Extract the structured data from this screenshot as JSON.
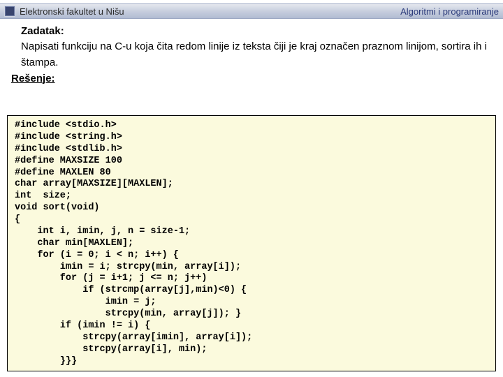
{
  "topbar": {
    "left": "Elektronski fakultet u Nišu",
    "right": "Algoritmi i programiranje"
  },
  "task": {
    "title": "Zadatak:",
    "body": "Napisati funkciju na C-u koja čita redom linije iz teksta čiji je kraj označen praznom linijom, sortira ih i štampa."
  },
  "solution": {
    "title": "Rešenje:"
  },
  "code": "#include <stdio.h>\n#include <string.h>\n#include <stdlib.h>\n#define MAXSIZE 100\n#define MAXLEN 80\nchar array[MAXSIZE][MAXLEN];\nint  size;\nvoid sort(void)\n{\n    int i, imin, j, n = size-1;\n    char min[MAXLEN];\n    for (i = 0; i < n; i++) {\n        imin = i; strcpy(min, array[i]);\n        for (j = i+1; j <= n; j++)\n            if (strcmp(array[j],min)<0) {\n                imin = j;\n                strcpy(min, array[j]); }\n        if (imin != i) {\n            strcpy(array[imin], array[i]);\n            strcpy(array[i], min);\n        }}}"
}
